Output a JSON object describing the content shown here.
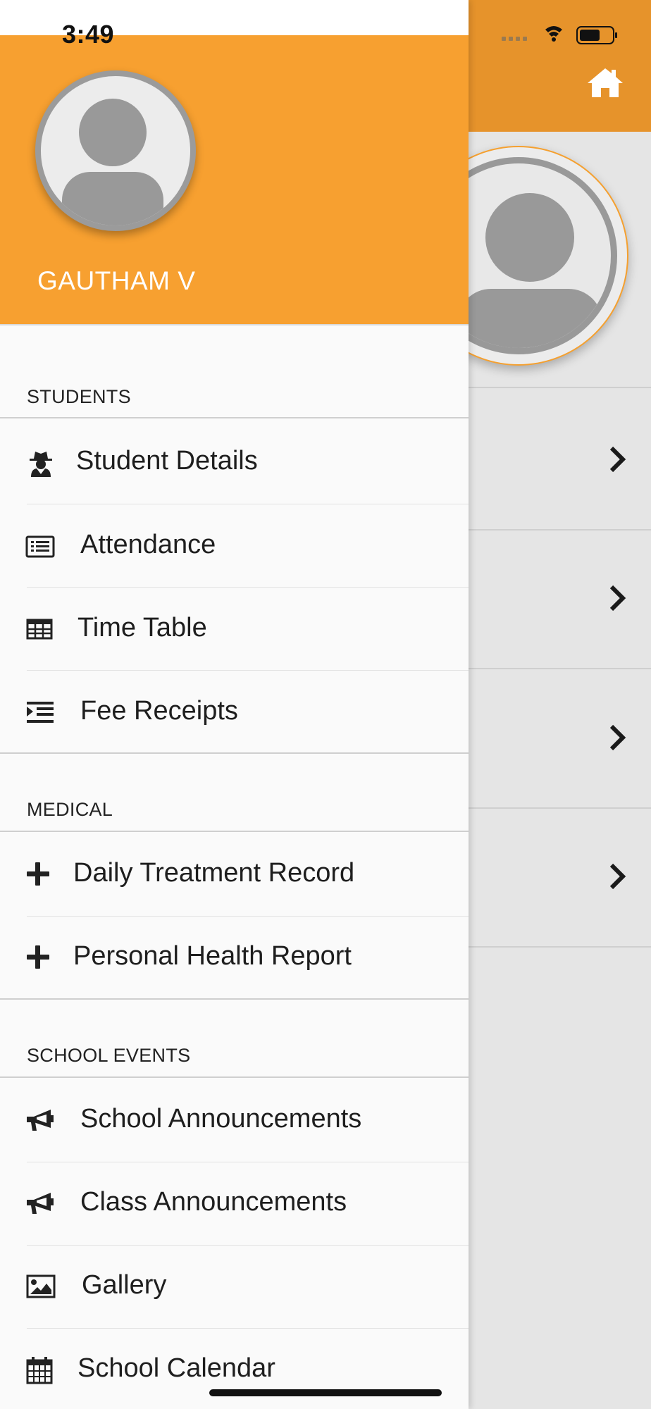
{
  "status_bar": {
    "time": "3:49"
  },
  "drawer": {
    "user_name": "GAUTHAM V",
    "sections": [
      {
        "title": "STUDENTS",
        "items": [
          {
            "label": "Student Details",
            "icon": "user-secret-icon"
          },
          {
            "label": "Attendance",
            "icon": "list-icon"
          },
          {
            "label": "Time Table",
            "icon": "table-icon"
          },
          {
            "label": "Fee Receipts",
            "icon": "indent-list-icon"
          }
        ]
      },
      {
        "title": "MEDICAL",
        "items": [
          {
            "label": "Daily Treatment Record",
            "icon": "plus-icon"
          },
          {
            "label": "Personal Health Report",
            "icon": "plus-icon"
          }
        ]
      },
      {
        "title": "SCHOOL EVENTS",
        "items": [
          {
            "label": "School Announcements",
            "icon": "megaphone-icon"
          },
          {
            "label": "Class Announcements",
            "icon": "megaphone-icon"
          },
          {
            "label": "Gallery",
            "icon": "image-icon"
          },
          {
            "label": "School Calendar",
            "icon": "calendar-icon"
          }
        ]
      }
    ]
  },
  "colors": {
    "drawer_header": "#f7a030",
    "app_header": "#e6932b",
    "background": "#e5e5e5"
  }
}
